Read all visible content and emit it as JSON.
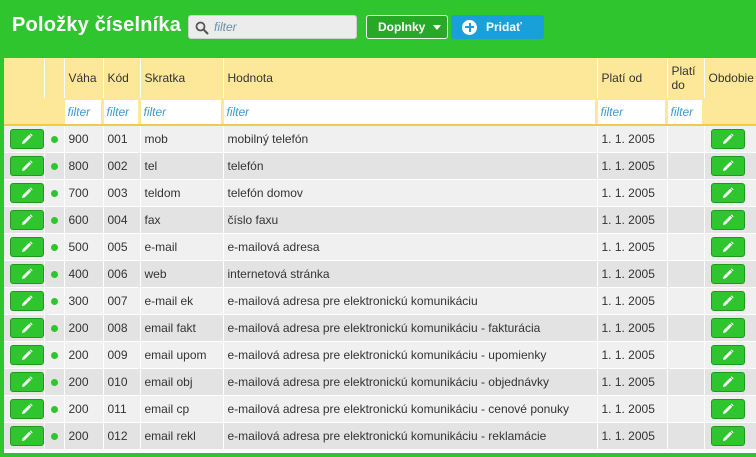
{
  "header": {
    "title": "Položky číselníka",
    "search_placeholder": "filter",
    "addons_label": "Doplnky",
    "add_label": "Pridať"
  },
  "colors": {
    "brand_green": "#2ec52e",
    "header_yellow": "#fde89a",
    "add_blue": "#1aa0d8"
  },
  "table": {
    "columns": {
      "vaha": "Váha",
      "kod": "Kód",
      "skratka": "Skratka",
      "hodnota": "Hodnota",
      "plati_od": "Platí od",
      "plati_do": "Platí do",
      "obdobie": "Obdobie"
    },
    "filter_placeholder": "filter",
    "rows": [
      {
        "vaha": "900",
        "kod": "001",
        "skratka": "mob",
        "hodnota": "mobilný telefón",
        "plati_od": "1. 1. 2005",
        "plati_do": ""
      },
      {
        "vaha": "800",
        "kod": "002",
        "skratka": "tel",
        "hodnota": "telefón",
        "plati_od": "1. 1. 2005",
        "plati_do": ""
      },
      {
        "vaha": "700",
        "kod": "003",
        "skratka": "teldom",
        "hodnota": "telefón domov",
        "plati_od": "1. 1. 2005",
        "plati_do": ""
      },
      {
        "vaha": "600",
        "kod": "004",
        "skratka": "fax",
        "hodnota": "číslo faxu",
        "plati_od": "1. 1. 2005",
        "plati_do": ""
      },
      {
        "vaha": "500",
        "kod": "005",
        "skratka": "e-mail",
        "hodnota": "e-mailová adresa",
        "plati_od": "1. 1. 2005",
        "plati_do": ""
      },
      {
        "vaha": "400",
        "kod": "006",
        "skratka": "web",
        "hodnota": "internetová stránka",
        "plati_od": "1. 1. 2005",
        "plati_do": ""
      },
      {
        "vaha": "300",
        "kod": "007",
        "skratka": "e-mail ek",
        "hodnota": "e-mailová adresa pre elektronickú komunikáciu",
        "plati_od": "1. 1. 2005",
        "plati_do": ""
      },
      {
        "vaha": "200",
        "kod": "008",
        "skratka": "email fakt",
        "hodnota": "e-mailová adresa pre elektronickú komunikáciu - fakturácia",
        "plati_od": "1. 1. 2005",
        "plati_do": ""
      },
      {
        "vaha": "200",
        "kod": "009",
        "skratka": "email upom",
        "hodnota": "e-mailová adresa pre elektronickú komunikáciu - upomienky",
        "plati_od": "1. 1. 2005",
        "plati_do": ""
      },
      {
        "vaha": "200",
        "kod": "010",
        "skratka": "email obj",
        "hodnota": "e-mailová adresa pre elektronickú komunikáciu - objednávky",
        "plati_od": "1. 1. 2005",
        "plati_do": ""
      },
      {
        "vaha": "200",
        "kod": "011",
        "skratka": "email cp",
        "hodnota": "e-mailová adresa pre elektronickú komunikáciu - cenové ponuky",
        "plati_od": "1. 1. 2005",
        "plati_do": ""
      },
      {
        "vaha": "200",
        "kod": "012",
        "skratka": "email rekl",
        "hodnota": "e-mailová adresa pre elektronickú komunikáciu - reklamácie",
        "plati_od": "1. 1. 2005",
        "plati_do": ""
      }
    ]
  }
}
